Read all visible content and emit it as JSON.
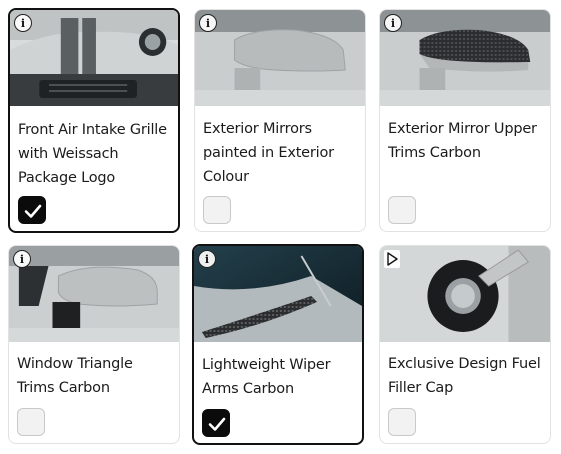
{
  "options": [
    {
      "id": "front-grille",
      "label": "Front Air Intake Grille with Weissach Package Logo",
      "checked": true,
      "badge": "info"
    },
    {
      "id": "mirrors-painted",
      "label": "Exterior Mirrors painted in Exterior Colour",
      "checked": false,
      "badge": "info"
    },
    {
      "id": "mirror-trims-carbon",
      "label": "Exterior Mirror Upper Trims Carbon",
      "checked": false,
      "badge": "info"
    },
    {
      "id": "window-triangle",
      "label": "Window Triangle Trims Carbon",
      "checked": false,
      "badge": "info"
    },
    {
      "id": "wiper-arms",
      "label": "Lightweight Wiper Arms Carbon",
      "checked": true,
      "badge": "info"
    },
    {
      "id": "fuel-cap",
      "label": "Exclusive Design Fuel Filler Cap",
      "checked": false,
      "badge": "play"
    }
  ],
  "info_glyph": "i",
  "colors": {
    "selected_border": "#111111",
    "checkbox_checked": "#0b0b0b",
    "checkbox_empty": "#f2f2f2"
  }
}
